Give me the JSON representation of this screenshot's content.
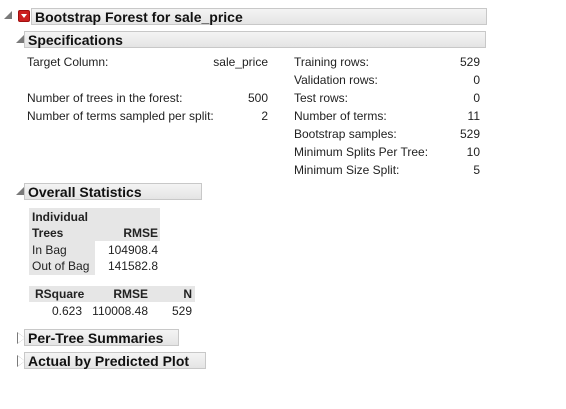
{
  "report": {
    "title": "Bootstrap Forest for sale_price"
  },
  "specifications": {
    "title": "Specifications",
    "left": [
      {
        "label": "Target Column:",
        "value": "sale_price"
      },
      {
        "label": "Number of trees in the forest:",
        "value": "500"
      },
      {
        "label": "Number of terms sampled per split:",
        "value": "2"
      }
    ],
    "right": [
      {
        "label": "Training rows:",
        "value": "529"
      },
      {
        "label": "Validation rows:",
        "value": "0"
      },
      {
        "label": "Test rows:",
        "value": "0"
      },
      {
        "label": "Number of terms:",
        "value": "11"
      },
      {
        "label": "Bootstrap samples:",
        "value": "529"
      },
      {
        "label": "Minimum Splits Per Tree:",
        "value": "10"
      },
      {
        "label": "Minimum Size Split:",
        "value": "5"
      }
    ]
  },
  "overall_statistics": {
    "title": "Overall Statistics",
    "trees_table": {
      "header_line1": "Individual",
      "header_line2": "Trees",
      "header_rmse": "RMSE",
      "rows": [
        {
          "label": "In Bag",
          "rmse": "104908.4"
        },
        {
          "label": "Out of Bag",
          "rmse": "141582.8"
        }
      ]
    },
    "fit_table": {
      "headers": [
        "RSquare",
        "RMSE",
        "N"
      ],
      "row": [
        "0.623",
        "110008.48",
        "529"
      ]
    }
  },
  "collapsed_sections": [
    {
      "title": "Per-Tree Summaries"
    },
    {
      "title": "Actual by Predicted Plot"
    }
  ],
  "colors": {
    "header_bg": "#e4e4e4",
    "table_header_bg": "#e6e6e6",
    "menu_red": "#cc1f1f"
  }
}
